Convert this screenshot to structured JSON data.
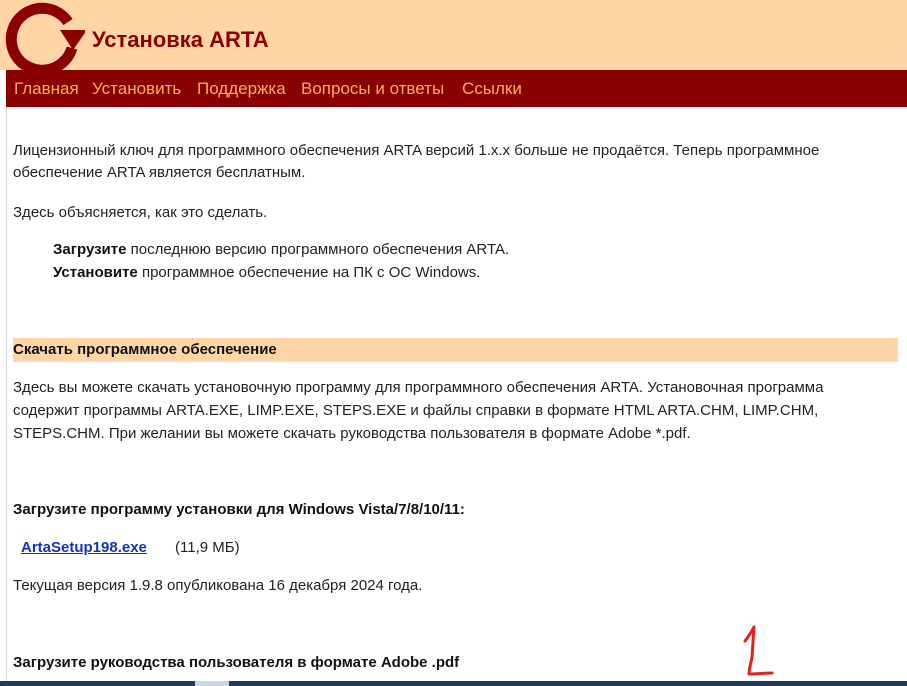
{
  "header": {
    "title": "Установка ARTA",
    "logo_icon": "circular-arrow-logo-icon",
    "bg_color": "#ffd5a6",
    "accent_color": "#8b0000"
  },
  "nav": {
    "bg_color": "#880000",
    "link_color": "#ffb14e",
    "items": [
      {
        "label": "Главная"
      },
      {
        "label": "Установить"
      },
      {
        "label": "Поддержка"
      },
      {
        "label": "Вопросы и ответы"
      },
      {
        "label": "Ссылки"
      }
    ]
  },
  "main": {
    "intro_line1": "Лицензионный ключ для программного обеспечения ARTA версий 1.x.x больше не продаётся. Теперь программное",
    "intro_line2": "обеспечение ARTA является бесплатным.",
    "explain": "Здесь объясняется, как это сделать.",
    "steps": [
      {
        "bold": "Загрузите",
        "rest": " последнюю версию программного обеспечения ARTA."
      },
      {
        "bold": "Установите",
        "rest": " программное обеспечение на ПК с ОС Windows."
      }
    ],
    "download_section": {
      "title": "Скачать программное обеспечение",
      "desc_line1": "Здесь вы можете скачать установочную программу для программного обеспечения ARTA. Установочная программа",
      "desc_line2": "содержит программы ARTA.EXE, LIMP.EXE, STEPS.EXE и файлы справки в формате HTML ARTA.CHM, LIMP.CHM,",
      "desc_line3": "STEPS.CHM. При желании вы можете скачать руководства пользователя в формате Adobe *.pdf."
    },
    "installer_heading": "Загрузите программу установки для Windows Vista/7/8/10/11:",
    "installer_file": {
      "name": "ArtaSetup198.exe",
      "size": "(11,9 МБ)"
    },
    "current_version": "Текущая версия 1.9.8 опубликована 16 декабря 2024 года.",
    "manuals_heading": "Загрузите руководства пользователя в формате Adobe .pdf"
  },
  "annotation": {
    "mark": "1",
    "color": "#e02020"
  }
}
